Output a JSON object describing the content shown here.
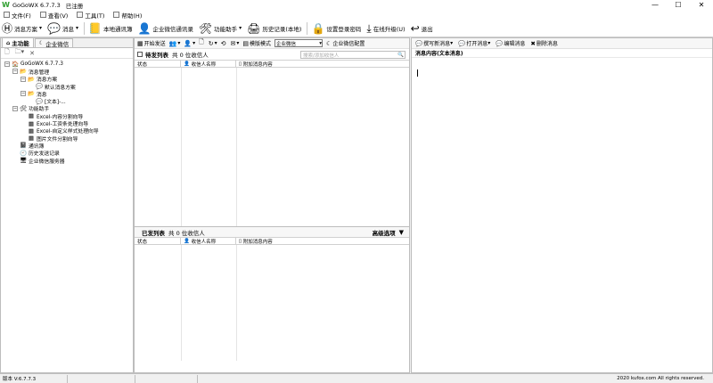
{
  "window": {
    "title": "GoGoWX 6.7.7.3",
    "status": "已注册"
  },
  "menu": [
    {
      "label": "文件(F)",
      "icon": "file-menu-icon"
    },
    {
      "label": "查看(V)",
      "icon": "view-menu-icon"
    },
    {
      "label": "工具(T)",
      "icon": "tools-menu-icon"
    },
    {
      "label": "帮助(H)",
      "icon": "help-menu-icon"
    }
  ],
  "toolbar": {
    "message_scheme": "消息方案",
    "message": "消息",
    "address_book": "本地通讯簿",
    "wechat_address_book": "企业微信通讯录",
    "function_assistant": "功能助手",
    "history": "历史记录(本地)",
    "login_password": "设置登录密码",
    "online_upgrade": "在线升级(U)",
    "exit": "退出"
  },
  "left_panel": {
    "tabs": [
      "主功能",
      "企业微信"
    ],
    "tree": [
      {
        "label": "GoGoWX 6.7.7.3",
        "indent": 0,
        "exp": "⊟",
        "icon": "🏠"
      },
      {
        "label": "消息管理",
        "indent": 1,
        "exp": "⊟",
        "icon": "📂"
      },
      {
        "label": "消息方案",
        "indent": 2,
        "exp": "⊟",
        "icon": "📂"
      },
      {
        "label": "默认消息方案",
        "indent": 3,
        "exp": "",
        "icon": "💬"
      },
      {
        "label": "消息",
        "indent": 2,
        "exp": "⊟",
        "icon": "📂"
      },
      {
        "label": "[文本]-...",
        "indent": 3,
        "exp": "",
        "icon": "💬"
      },
      {
        "label": "功能助手",
        "indent": 1,
        "exp": "⊟",
        "icon": "🛠"
      },
      {
        "label": "Excel-内容分割向导",
        "indent": 2,
        "exp": "",
        "icon": "▦"
      },
      {
        "label": "Excel-工资条处理向导",
        "indent": 2,
        "exp": "",
        "icon": "▦"
      },
      {
        "label": "Excel-自定义样式处理向导",
        "indent": 2,
        "exp": "",
        "icon": "▦"
      },
      {
        "label": "图片文件分割向导",
        "indent": 2,
        "exp": "",
        "icon": "▦"
      },
      {
        "label": "通讯簿",
        "indent": 1,
        "exp": "",
        "icon": "📓"
      },
      {
        "label": "历史发送记录",
        "indent": 1,
        "exp": "",
        "icon": "🕘"
      },
      {
        "label": "企业微信服务器",
        "indent": 1,
        "exp": "",
        "icon": "🖥"
      }
    ]
  },
  "middle_panel": {
    "toolbar": {
      "start_send": "开始发送",
      "template_mode": "模版模式",
      "selected_channel": "企业微信",
      "config": "企业微信配置"
    },
    "pending": {
      "title": "待发列表",
      "count_text": "共 0 位收信人",
      "search_placeholder": "搜索/添加收信人",
      "columns": [
        "状态",
        "收信人名称",
        "附加消息内容"
      ]
    },
    "sent": {
      "title": "已发列表",
      "count_text": "共 0 位收信人",
      "advanced": "高级选项",
      "columns": [
        "状态",
        "收信人名称",
        "附加消息内容"
      ]
    }
  },
  "right_panel": {
    "toolbar": [
      "撰写新消息",
      "打开消息",
      "编辑消息",
      "删除消息"
    ],
    "content_label": "消息内容(文本消息)"
  },
  "statusbar": {
    "version": "版本 V:6.7.7.3",
    "copyright": "2020 kufox.com All rights reserved."
  }
}
